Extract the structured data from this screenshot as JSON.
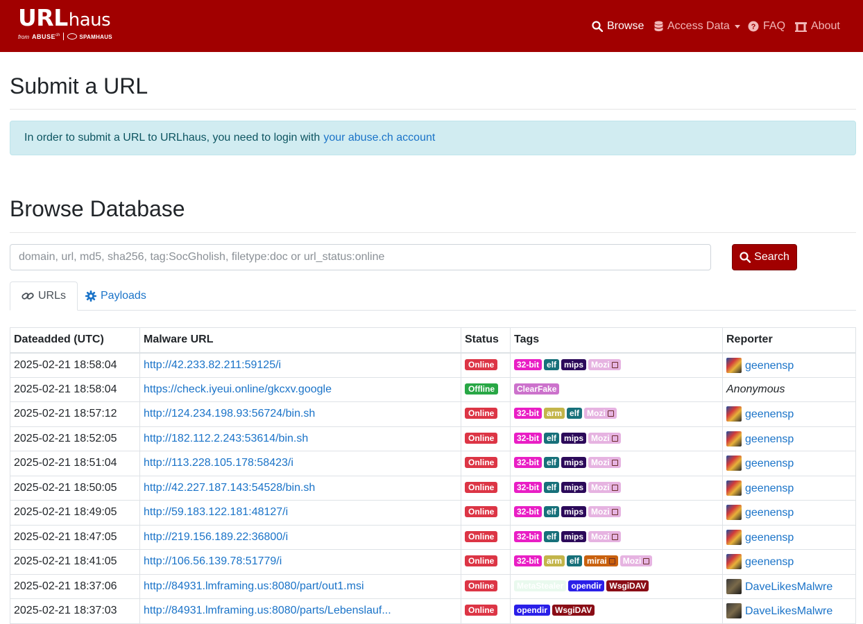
{
  "brand": {
    "url": "URL",
    "haus": "haus",
    "from": "from",
    "abuse": "ABUSE",
    "abuse_sup": "ch",
    "spamhaus": "SPAMHAUS"
  },
  "nav": {
    "browse": "Browse",
    "access_data": "Access Data",
    "faq": "FAQ",
    "about": "About"
  },
  "submit": {
    "title": "Submit a URL",
    "alert_text": "In order to submit a URL to URLhaus, you need to login with",
    "alert_link": "your abuse.ch account"
  },
  "browse": {
    "title": "Browse Database",
    "search_placeholder": "domain, url, md5, sha256, tag:SocGholish, filetype:doc or url_status:online",
    "search_button": "Search",
    "tabs": [
      {
        "label": "URLs"
      },
      {
        "label": "Payloads"
      }
    ]
  },
  "table": {
    "headers": [
      "Dateadded (UTC)",
      "Malware URL",
      "Status",
      "Tags",
      "Reporter"
    ],
    "rows": [
      {
        "date": "2025-02-21 18:58:04",
        "url": "http://42.233.82.211:59125/i",
        "status": "Online",
        "tags": [
          {
            "t": "32-bit",
            "c": "#e91ec5"
          },
          {
            "t": "elf",
            "c": "#17707a"
          },
          {
            "t": "mips",
            "c": "#2c0a5a"
          },
          {
            "t": "Mozi",
            "c": "#e6b3e1",
            "ext": true
          }
        ],
        "reporter": "geenensp",
        "avatar": "av1"
      },
      {
        "date": "2025-02-21 18:58:04",
        "url": "https://check.iyeui.online/gkcxv.google",
        "status": "Offline",
        "tags": [
          {
            "t": "ClearFake",
            "c": "#cc72cc"
          }
        ],
        "reporter": "Anonymous",
        "anonymous": true
      },
      {
        "date": "2025-02-21 18:57:12",
        "url": "http://124.234.198.93:56724/bin.sh",
        "status": "Online",
        "tags": [
          {
            "t": "32-bit",
            "c": "#e91ec5"
          },
          {
            "t": "arm",
            "c": "#c3b54a"
          },
          {
            "t": "elf",
            "c": "#17707a"
          },
          {
            "t": "Mozi",
            "c": "#e6b3e1",
            "ext": true
          }
        ],
        "reporter": "geenensp",
        "avatar": "av1"
      },
      {
        "date": "2025-02-21 18:52:05",
        "url": "http://182.112.2.243:53614/bin.sh",
        "status": "Online",
        "tags": [
          {
            "t": "32-bit",
            "c": "#e91ec5"
          },
          {
            "t": "elf",
            "c": "#17707a"
          },
          {
            "t": "mips",
            "c": "#2c0a5a"
          },
          {
            "t": "Mozi",
            "c": "#e6b3e1",
            "ext": true
          }
        ],
        "reporter": "geenensp",
        "avatar": "av1"
      },
      {
        "date": "2025-02-21 18:51:04",
        "url": "http://113.228.105.178:58423/i",
        "status": "Online",
        "tags": [
          {
            "t": "32-bit",
            "c": "#e91ec5"
          },
          {
            "t": "elf",
            "c": "#17707a"
          },
          {
            "t": "mips",
            "c": "#2c0a5a"
          },
          {
            "t": "Mozi",
            "c": "#e6b3e1",
            "ext": true
          }
        ],
        "reporter": "geenensp",
        "avatar": "av1"
      },
      {
        "date": "2025-02-21 18:50:05",
        "url": "http://42.227.187.143:54528/bin.sh",
        "status": "Online",
        "tags": [
          {
            "t": "32-bit",
            "c": "#e91ec5"
          },
          {
            "t": "elf",
            "c": "#17707a"
          },
          {
            "t": "mips",
            "c": "#2c0a5a"
          },
          {
            "t": "Mozi",
            "c": "#e6b3e1",
            "ext": true
          }
        ],
        "reporter": "geenensp",
        "avatar": "av1"
      },
      {
        "date": "2025-02-21 18:49:05",
        "url": "http://59.183.122.181:48127/i",
        "status": "Online",
        "tags": [
          {
            "t": "32-bit",
            "c": "#e91ec5"
          },
          {
            "t": "elf",
            "c": "#17707a"
          },
          {
            "t": "mips",
            "c": "#2c0a5a"
          },
          {
            "t": "Mozi",
            "c": "#e6b3e1",
            "ext": true
          }
        ],
        "reporter": "geenensp",
        "avatar": "av1"
      },
      {
        "date": "2025-02-21 18:47:05",
        "url": "http://219.156.189.22:36800/i",
        "status": "Online",
        "tags": [
          {
            "t": "32-bit",
            "c": "#e91ec5"
          },
          {
            "t": "elf",
            "c": "#17707a"
          },
          {
            "t": "mips",
            "c": "#2c0a5a"
          },
          {
            "t": "Mozi",
            "c": "#e6b3e1",
            "ext": true
          }
        ],
        "reporter": "geenensp",
        "avatar": "av1"
      },
      {
        "date": "2025-02-21 18:41:05",
        "url": "http://106.56.139.78:51779/i",
        "status": "Online",
        "tags": [
          {
            "t": "32-bit",
            "c": "#e91ec5"
          },
          {
            "t": "arm",
            "c": "#c3b54a"
          },
          {
            "t": "elf",
            "c": "#17707a"
          },
          {
            "t": "mirai",
            "c": "#c9610e",
            "ext": true
          },
          {
            "t": "Mozi",
            "c": "#e6b3e1",
            "ext": true
          }
        ],
        "reporter": "geenensp",
        "avatar": "av1"
      },
      {
        "date": "2025-02-21 18:37:06",
        "url": "http://84931.lmframing.us:8080/part/out1.msi",
        "status": "Online",
        "tags": [
          {
            "t": "MetaStealer",
            "c": "#e9f9ee",
            "light": true
          },
          {
            "t": "opendir",
            "c": "#2a1fe8"
          },
          {
            "t": "WsgiDAV",
            "c": "#8a0d16"
          }
        ],
        "reporter": "DaveLikesMalwre",
        "avatar": "av2"
      },
      {
        "date": "2025-02-21 18:37:03",
        "url": "http://84931.lmframing.us:8080/parts/Lebenslauf...",
        "status": "Online",
        "tags": [
          {
            "t": "opendir",
            "c": "#2a1fe8"
          },
          {
            "t": "WsgiDAV",
            "c": "#8a0d16"
          }
        ],
        "reporter": "DaveLikesMalwre",
        "avatar": "av2"
      }
    ]
  },
  "colors": {
    "brand": "#a10000",
    "status_online": "#dc3545",
    "status_offline": "#28a745",
    "link": "#1a73c8"
  },
  "icons": [
    "search-icon",
    "database-icon",
    "question-circle-icon",
    "university-icon",
    "link-icon",
    "gear-icon",
    "external-link-icon"
  ]
}
